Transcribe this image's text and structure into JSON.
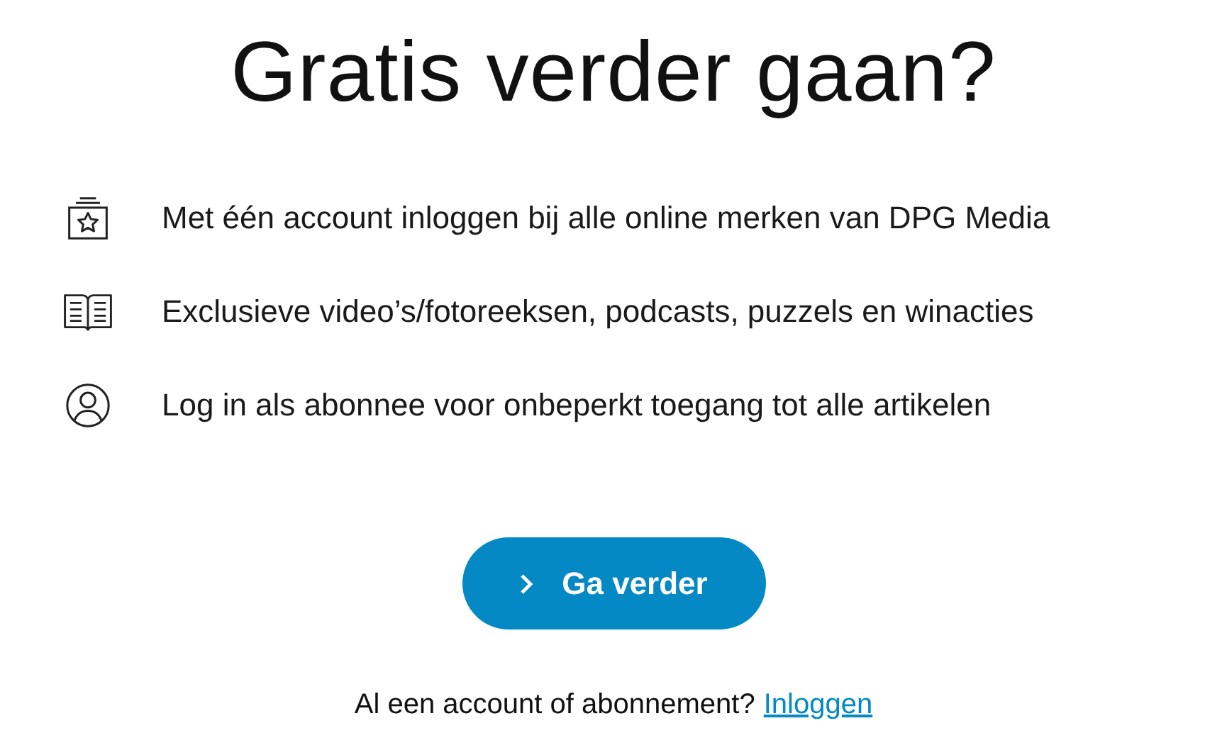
{
  "title": "Gratis verder gaan?",
  "benefits": [
    {
      "kind": "account",
      "text": "Met één account inloggen bij alle online merken van DPG Media"
    },
    {
      "kind": "media",
      "text": "Exclusieve video’s/fotoreeksen, podcasts, puzzels en winacties"
    },
    {
      "kind": "user",
      "text": "Log in als abonnee voor onbeperkt toegang tot alle artikelen"
    }
  ],
  "button": {
    "label": "Ga verder"
  },
  "footer": {
    "text": "Al een account of abonnement?",
    "link": "Inloggen"
  }
}
